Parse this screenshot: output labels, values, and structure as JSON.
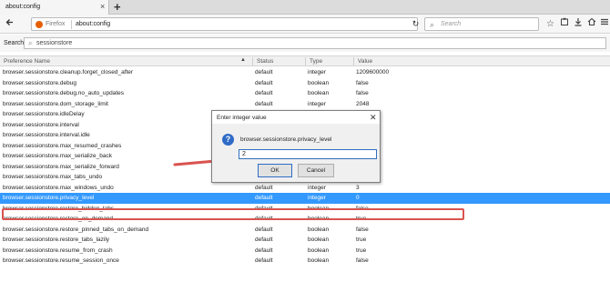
{
  "tab": {
    "title": "about:config",
    "close": "×",
    "new": "+"
  },
  "nav": {
    "back_icon": "back-arrow-icon",
    "identity_label": "Firefox",
    "url": "about:config",
    "reload": "↻",
    "search_placeholder": "Search",
    "toolbar_icons": [
      "star-icon",
      "reading-list-icon",
      "download-icon",
      "home-icon",
      "menu-icon"
    ]
  },
  "filter": {
    "label": "Search:",
    "value": "sessionstore"
  },
  "table": {
    "headers": {
      "name": "Preference Name",
      "status": "Status",
      "type": "Type",
      "value": "Value"
    },
    "rows": [
      {
        "name": "browser.sessionstore.cleanup.forget_closed_after",
        "status": "default",
        "type": "integer",
        "value": "1209600000"
      },
      {
        "name": "browser.sessionstore.debug",
        "status": "default",
        "type": "boolean",
        "value": "false"
      },
      {
        "name": "browser.sessionstore.debug.no_auto_updates",
        "status": "default",
        "type": "boolean",
        "value": "false"
      },
      {
        "name": "browser.sessionstore.dom_storage_limit",
        "status": "default",
        "type": "integer",
        "value": "2048"
      },
      {
        "name": "browser.sessionstore.idleDelay",
        "status": "",
        "type": "",
        "value": ""
      },
      {
        "name": "browser.sessionstore.interval",
        "status": "",
        "type": "",
        "value": ""
      },
      {
        "name": "browser.sessionstore.interval.idle",
        "status": "",
        "type": "",
        "value": ""
      },
      {
        "name": "browser.sessionstore.max_resumed_crashes",
        "status": "",
        "type": "",
        "value": ""
      },
      {
        "name": "browser.sessionstore.max_serialize_back",
        "status": "",
        "type": "",
        "value": ""
      },
      {
        "name": "browser.sessionstore.max_serialize_forward",
        "status": "",
        "type": "",
        "value": ""
      },
      {
        "name": "browser.sessionstore.max_tabs_undo",
        "status": "default",
        "type": "integer",
        "value": "10"
      },
      {
        "name": "browser.sessionstore.max_windows_undo",
        "status": "default",
        "type": "integer",
        "value": "3"
      },
      {
        "name": "browser.sessionstore.privacy_level",
        "status": "default",
        "type": "integer",
        "value": "0",
        "selected": true
      },
      {
        "name": "browser.sessionstore.restore_hidden_tabs",
        "status": "default",
        "type": "boolean",
        "value": "false"
      },
      {
        "name": "browser.sessionstore.restore_on_demand",
        "status": "default",
        "type": "boolean",
        "value": "true"
      },
      {
        "name": "browser.sessionstore.restore_pinned_tabs_on_demand",
        "status": "default",
        "type": "boolean",
        "value": "false"
      },
      {
        "name": "browser.sessionstore.restore_tabs_lazily",
        "status": "default",
        "type": "boolean",
        "value": "true"
      },
      {
        "name": "browser.sessionstore.resume_from_crash",
        "status": "default",
        "type": "boolean",
        "value": "true"
      },
      {
        "name": "browser.sessionstore.resume_session_once",
        "status": "default",
        "type": "boolean",
        "value": "false"
      }
    ]
  },
  "dialog": {
    "title": "Enter integer value",
    "close": "✕",
    "icon": "question-icon",
    "preference": "browser.sessionstore.privacy_level",
    "input_value": "2",
    "ok_label": "OK",
    "cancel_label": "Cancel"
  },
  "colors": {
    "selection": "#3399ff",
    "annotation": "#d9534f",
    "firefox": "#e66000"
  }
}
